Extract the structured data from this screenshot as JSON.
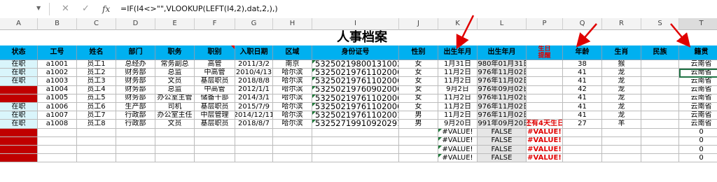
{
  "formula_bar": {
    "name_box": "",
    "cancel_icon": "✕",
    "enter_icon": "✓",
    "fx_label": "fx",
    "formula": "=IF(I4<>\"\",VLOOKUP(LEFT(I4,2),dat,2,),)"
  },
  "columns": [
    "A",
    "B",
    "C",
    "D",
    "E",
    "F",
    "G",
    "H",
    "I",
    "J",
    "K",
    "L",
    "P",
    "Q",
    "R",
    "S",
    "T"
  ],
  "title": "人事档案",
  "headers": [
    "状态",
    "工号",
    "姓名",
    "部门",
    "职务",
    "职别",
    "入职日期",
    "区域",
    "身份证号",
    "性别",
    "出生年月",
    "出生年月",
    "生日提醒",
    "年龄",
    "生肖",
    "民族",
    "籍贯"
  ],
  "birthday_header": [
    "生日",
    "提醒"
  ],
  "rows": [
    {
      "status": "在职",
      "id": "a1001",
      "name": "员工1",
      "dept": "总经办",
      "job": "常务副总",
      "level": "高管",
      "date": "2011/3/2",
      "area": "南京",
      "idcard": "532502198001310027",
      "sex": "女",
      "bmd": "1月31日",
      "bdate": "1980年01月31日",
      "remind": "",
      "age": "38",
      "zodiac": "猴",
      "nation": "",
      "origin": "云南省"
    },
    {
      "status": "在职",
      "id": "a1002",
      "name": "员工2",
      "dept": "财务部",
      "job": "总监",
      "level": "中高管",
      "date": "2010/4/13",
      "area": "哈尔滨",
      "idcard": "532502197611020068",
      "sex": "女",
      "bmd": "11月2日",
      "bdate": "1976年11月02日",
      "remind": "",
      "age": "41",
      "zodiac": "龙",
      "nation": "",
      "origin": "云南省"
    },
    {
      "status": "在职",
      "id": "a1003",
      "name": "员工3",
      "dept": "财务部",
      "job": "文员",
      "level": "基层职员",
      "date": "2018/8/8",
      "area": "哈尔滨",
      "idcard": "532502197611020068",
      "sex": "女",
      "bmd": "11月2日",
      "bdate": "1976年11月02日",
      "remind": "",
      "age": "41",
      "zodiac": "龙",
      "nation": "",
      "origin": "云南省"
    },
    {
      "status": "离职",
      "id": "a1004",
      "name": "员工4",
      "dept": "财务部",
      "job": "总监",
      "level": "中高管",
      "date": "2012/1/1",
      "area": "哈尔滨",
      "idcard": "532502197609020068",
      "sex": "女",
      "bmd": "9月2日",
      "bdate": "1976年09月02日",
      "remind": "",
      "age": "42",
      "zodiac": "龙",
      "nation": "",
      "origin": "云南省"
    },
    {
      "status": "离职",
      "id": "a1005",
      "name": "员工5",
      "dept": "财务部",
      "job": "办公室主管",
      "level": "储备干部",
      "date": "2014/3/1",
      "area": "哈尔滨",
      "idcard": "532502197611020068",
      "sex": "女",
      "bmd": "11月2日",
      "bdate": "1976年11月02日",
      "remind": "",
      "age": "41",
      "zodiac": "龙",
      "nation": "",
      "origin": "云南省"
    },
    {
      "status": "在职",
      "id": "a1006",
      "name": "员工6",
      "dept": "生产部",
      "job": "司机",
      "level": "基层职员",
      "date": "2015/7/9",
      "area": "哈尔滨",
      "idcard": "532502197611020068",
      "sex": "女",
      "bmd": "11月2日",
      "bdate": "1976年11月02日",
      "remind": "",
      "age": "41",
      "zodiac": "龙",
      "nation": "",
      "origin": "云南省"
    },
    {
      "status": "在职",
      "id": "a1007",
      "name": "员工7",
      "dept": "行政部",
      "job": "办公室主任",
      "level": "中层管理",
      "date": "2014/12/11",
      "area": "哈尔滨",
      "idcard": "532502197611020018",
      "sex": "男",
      "bmd": "11月2日",
      "bdate": "1976年11月02日",
      "remind": "",
      "age": "41",
      "zodiac": "龙",
      "nation": "",
      "origin": "云南省"
    },
    {
      "status": "在职",
      "id": "a1008",
      "name": "员工8",
      "dept": "行政部",
      "job": "文员",
      "level": "基层职员",
      "date": "2018/8/7",
      "area": "哈尔滨",
      "idcard": "532527199109202913",
      "sex": "男",
      "bmd": "9月20日",
      "bdate": "1991年09月20日",
      "remind": "还有4天生日",
      "age": "27",
      "zodiac": "羊",
      "nation": "",
      "origin": "云南省"
    }
  ],
  "error_rows": [
    {
      "bmd": "#VALUE!",
      "bdate": "FALSE",
      "remind": "#VALUE!",
      "origin": "0"
    },
    {
      "bmd": "#VALUE!",
      "bdate": "FALSE",
      "remind": "#VALUE!",
      "origin": "0"
    },
    {
      "bmd": "#VALUE!",
      "bdate": "FALSE",
      "remind": "#VALUE!",
      "origin": "0"
    },
    {
      "bmd": "#VALUE!",
      "bdate": "FALSE",
      "remind": "#VALUE!",
      "origin": "0"
    }
  ],
  "colors": {
    "header_bg": "#00b0f0",
    "status_ok_bg": "#d9f5fb",
    "status_left_bg": "#c00000",
    "error_red": "#e00000",
    "selection": "#217346",
    "arrow": "#e00000"
  }
}
